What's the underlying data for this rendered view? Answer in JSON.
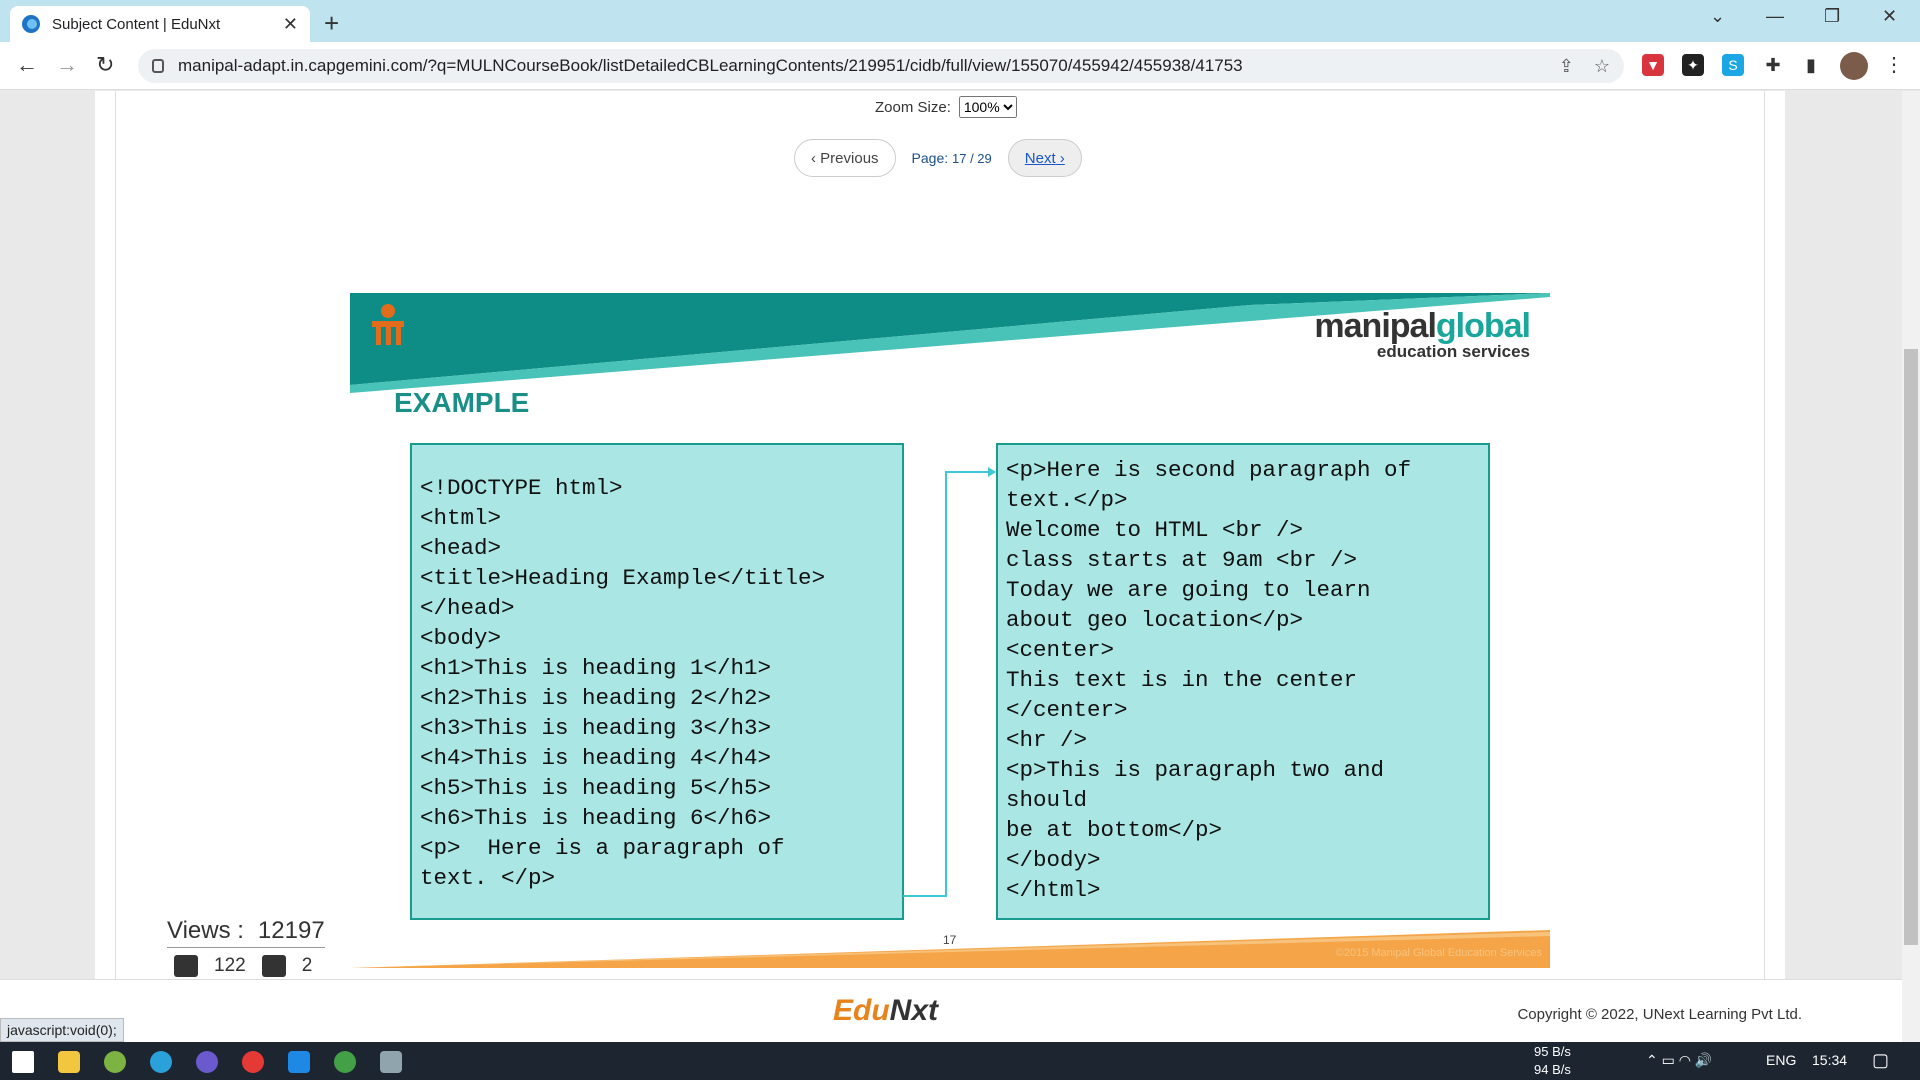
{
  "browser": {
    "tab_title": "Subject Content | EduNxt",
    "url": "manipal-adapt.in.capgemini.com/?q=MULNCourseBook/listDetailedCBLearningContents/219951/cidb/full/view/155070/455942/455938/41753"
  },
  "viewer": {
    "zoom_label": "Zoom Size:",
    "zoom_value": "100%",
    "prev_label": "Previous",
    "page_label": "Page:",
    "page_value": "17 / 29",
    "next_label": "Next"
  },
  "slide": {
    "brand_main": "manipal",
    "brand_accent": "global",
    "brand_sub": "education services",
    "title": "EXAMPLE",
    "left_code": "<!DOCTYPE html>\n<html>\n<head>\n<title>Heading Example</title>\n</head>\n<body>\n<h1>This is heading 1</h1>\n<h2>This is heading 2</h2>\n<h3>This is heading 3</h3>\n<h4>This is heading 4</h4>\n<h5>This is heading 5</h5>\n<h6>This is heading 6</h6>\n<p>  Here is a paragraph of\ntext. </p>",
    "right_code": "<p>Here is second paragraph of\ntext.</p>\nWelcome to HTML <br />\nclass starts at 9am <br />\nToday we are going to learn\nabout geo location</p>\n<center>\nThis text is in the center\n</center>\n<hr />\n<p>This is paragraph two and\nshould\nbe at bottom</p>\n</body>\n</html>",
    "page_number": "17",
    "copyright": "©2015 Manipal Global Education Services"
  },
  "stats": {
    "views_label": "Views :",
    "views_value": "12197",
    "likes": "122",
    "dislikes": "2"
  },
  "footer": {
    "logo_a": "Edu",
    "logo_b": "Nxt",
    "copyright": "Copyright © 2022, UNext Learning Pvt Ltd.",
    "status_text": "javascript:void(0);"
  },
  "taskbar": {
    "net_up": "95 B/s",
    "net_down": "94 B/s",
    "lang": "ENG",
    "time": "15:34"
  },
  "colors": {
    "teal": "#1aa69a",
    "code_bg": "#aae6e3",
    "orange": "#f5a548"
  }
}
